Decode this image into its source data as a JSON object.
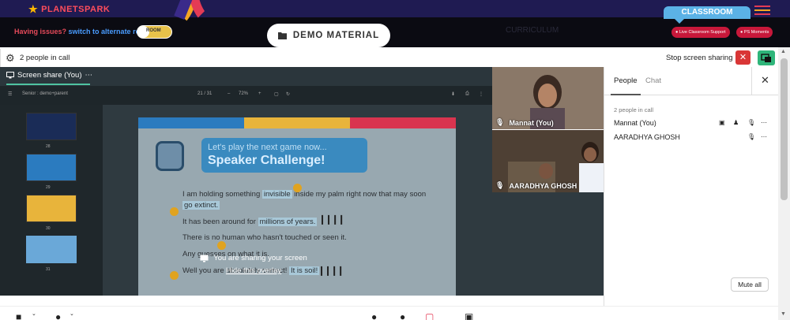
{
  "topbar": {
    "logo": "PLANETSPARK",
    "issue_text": "Having issues?",
    "alt_room_link": "switch to alternate room",
    "toggle_label": "ROOM",
    "demo_button": "DEMO MATERIAL",
    "curriculum_label": "CURRICULUM",
    "classroom_tab": "CLASSROOM",
    "support_pill": "Live Classroom Support",
    "moments_pill": "PS Moments"
  },
  "meet_toolbar": {
    "people_count": "2 people in call",
    "stop_share": "Stop screen sharing"
  },
  "share": {
    "tab_label": "Screen share (You)",
    "more": "⋯",
    "pdf_title": "Senior : demo+parent",
    "pdf_page": "21 / 31",
    "pdf_zoom": "72%",
    "thumbs": [
      {
        "num": "28",
        "color": "#1a2c57"
      },
      {
        "num": "29",
        "color": "#2b7bbf"
      },
      {
        "num": "30",
        "color": "#e8b43b"
      },
      {
        "num": "31",
        "color": "#6aa8d8"
      }
    ],
    "slide": {
      "bubble_line1": "Let's play the next game now...",
      "bubble_line2": "Speaker Challenge!",
      "line1_pre": "I am holding something ",
      "line1_hl": "invisible",
      "line1_post": " inside my palm right now that may soon",
      "line1b": "go extinct.",
      "line2_pre": "It has been around for ",
      "line2_hl": "millions of years.",
      "line3": "There is no human who hasn't touched or seen it.",
      "line4": "Any guesses on what it is.",
      "line5_pre": "Well you are absolutely correct! ",
      "line5_hl": "It is soil!"
    },
    "overlay_title": "You are sharing your screen",
    "overlay_link": "Hide this overlay"
  },
  "participants": {
    "tile1_name": "Mannat (You)",
    "tile2_name": "AARADHYA GHOSH"
  },
  "panel": {
    "tab_people": "People",
    "tab_chat": "Chat",
    "in_call": "2 people in call",
    "people": [
      {
        "name": "Mannat (You)"
      },
      {
        "name": "AARADHYA GHOSH"
      }
    ],
    "mute_all": "Mute all"
  },
  "colors": {
    "accent_green": "#2fb57a",
    "stop_red": "#d93636",
    "brand_red": "#e43b55",
    "brand_orange": "#f5a623"
  }
}
